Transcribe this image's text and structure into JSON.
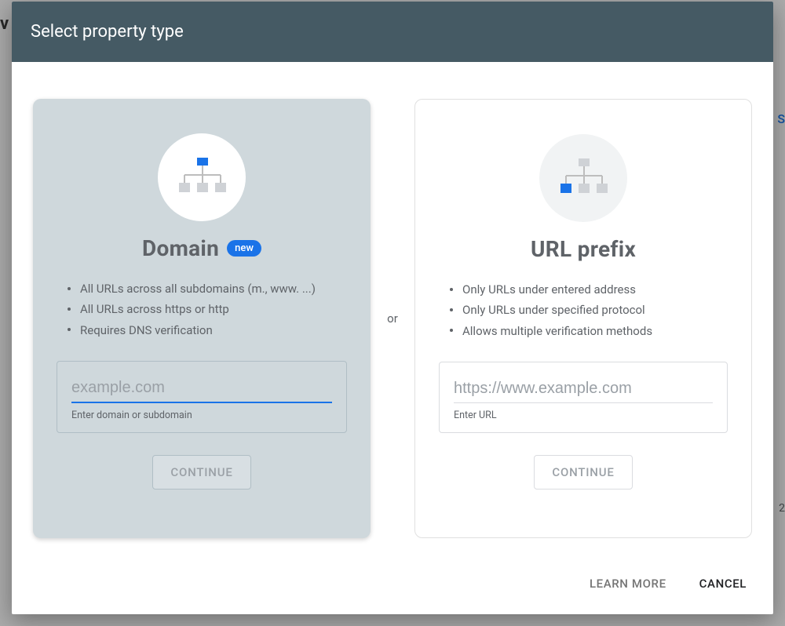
{
  "dialog": {
    "title": "Select property type",
    "or_label": "or",
    "footer": {
      "learn_more": "LEARN MORE",
      "cancel": "CANCEL"
    }
  },
  "icons": {
    "domain": "sitemap-domain-icon",
    "url": "sitemap-url-icon"
  },
  "domain_card": {
    "title": "Domain",
    "badge": "new",
    "bullets": [
      "All URLs across all subdomains (m., www. ...)",
      "All URLs across https or http",
      "Requires DNS verification"
    ],
    "input_placeholder": "example.com",
    "input_value": "",
    "helper": "Enter domain or subdomain",
    "button": "CONTINUE"
  },
  "url_card": {
    "title": "URL prefix",
    "bullets": [
      "Only URLs under entered address",
      "Only URLs under specified protocol",
      "Allows multiple verification methods"
    ],
    "input_placeholder": "https://www.example.com",
    "input_value": "",
    "helper": "Enter URL",
    "button": "CONTINUE"
  }
}
